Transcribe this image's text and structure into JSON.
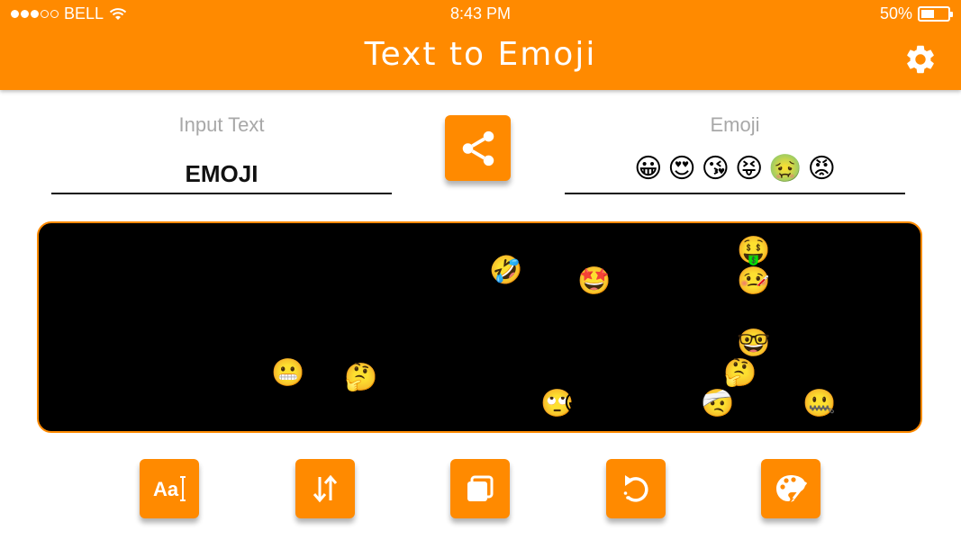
{
  "status_bar": {
    "carrier": "BELL",
    "time": "8:43 PM",
    "battery": "50%",
    "battery_level": 0.5
  },
  "header": {
    "title": "Text to Emoji",
    "settings_icon": "gear-icon"
  },
  "input": {
    "label": "Input Text",
    "value": "EMOJI"
  },
  "output": {
    "label": "Emoji",
    "emojis": [
      "😀",
      "😍",
      "😘",
      "😝",
      "🤢",
      "😡"
    ]
  },
  "share": {
    "icon": "share-icon"
  },
  "canvas": {
    "text": "EMOJI",
    "emoji_art": [
      "😂",
      "😄",
      "😀",
      "😁",
      "😆",
      "😍",
      "😋",
      "😌",
      "😅",
      "😉",
      "😇",
      "😍",
      "😎",
      "😏",
      "😛",
      "😖",
      "😘",
      "😐",
      "😚",
      "😰",
      "😇",
      "😓",
      "😭",
      "🤔",
      "😬",
      "😲",
      "😍",
      "😂",
      "😆",
      "😣",
      "😫",
      "😡",
      "😥",
      "😞",
      "😙",
      "😞",
      "🤣",
      "😰",
      "😒",
      "🤩",
      "😖",
      "😩",
      "😷",
      "🙄",
      "😃",
      "😲",
      "😱",
      "😟",
      "🤕",
      "🤑",
      "🤒",
      "😜",
      "🤓",
      "🤔",
      "😨",
      "😐",
      "😳",
      "😴",
      "😵",
      "🤐",
      "😞",
      "😯"
    ]
  },
  "toolbar": {
    "buttons": [
      {
        "id": "font",
        "icon": "font-icon",
        "label": "Aa"
      },
      {
        "id": "orientation",
        "icon": "swap-vertical-icon"
      },
      {
        "id": "copy",
        "icon": "copy-icon"
      },
      {
        "id": "reset",
        "icon": "rotate-left-icon"
      },
      {
        "id": "palette",
        "icon": "palette-icon"
      }
    ]
  },
  "colors": {
    "primary": "#FF8A00",
    "canvas_bg": "#000000",
    "label": "#a8a8a8"
  }
}
